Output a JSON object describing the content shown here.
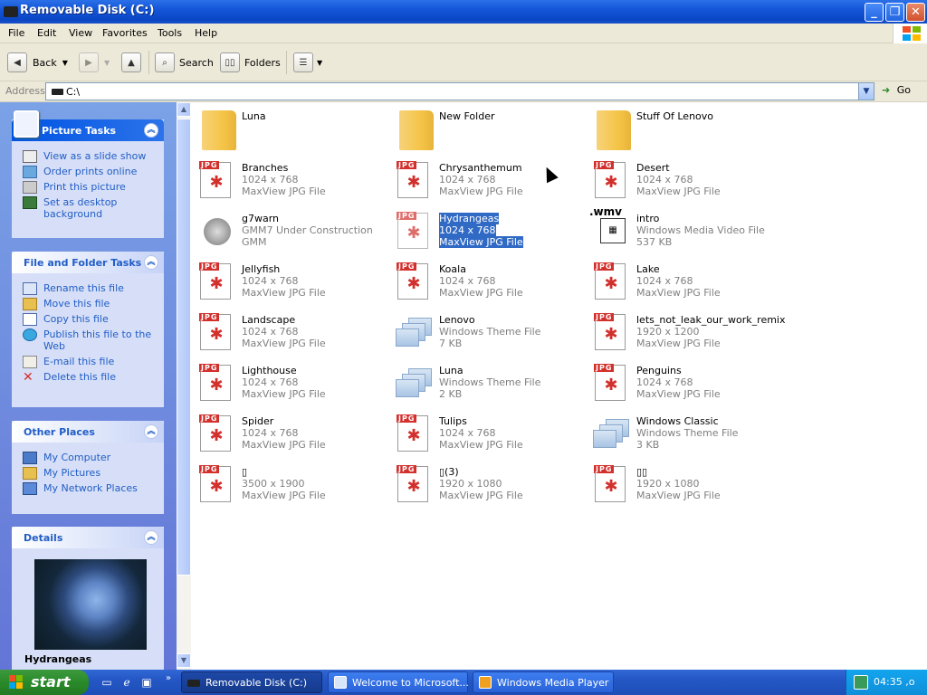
{
  "window": {
    "title": "Removable Disk (C:)"
  },
  "menu": [
    "File",
    "Edit",
    "View",
    "Favorites",
    "Tools",
    "Help"
  ],
  "toolbar": {
    "back_label": "Back",
    "search_label": "Search",
    "folders_label": "Folders"
  },
  "address": {
    "label": "Address",
    "value": "C:\\",
    "go_label": "Go"
  },
  "picture_tasks": {
    "title": "Picture Tasks",
    "items": [
      "View as a slide show",
      "Order prints online",
      "Print this picture",
      "Set as desktop background"
    ]
  },
  "file_tasks": {
    "title": "File and Folder Tasks",
    "items": [
      "Rename this file",
      "Move this file",
      "Copy this file",
      "Publish this file to the Web",
      "E-mail this file",
      "Delete this file"
    ]
  },
  "other_places": {
    "title": "Other Places",
    "items": [
      "My Computer",
      "My Pictures",
      "My Network Places"
    ]
  },
  "details": {
    "title": "Details",
    "name": "Hydrangeas"
  },
  "files": [
    {
      "name": "Luna",
      "line2": "",
      "line3": "",
      "type": "folder"
    },
    {
      "name": "New Folder",
      "line2": "",
      "line3": "",
      "type": "folder"
    },
    {
      "name": "Stuff Of Lenovo",
      "line2": "",
      "line3": "",
      "type": "folder"
    },
    {
      "name": "Branches",
      "line2": "1024 x 768",
      "line3": "MaxView JPG File",
      "type": "jpg"
    },
    {
      "name": "Chrysanthemum",
      "line2": "1024 x 768",
      "line3": "MaxView JPG File",
      "type": "jpg"
    },
    {
      "name": "Desert",
      "line2": "1024 x 768",
      "line3": "MaxView JPG File",
      "type": "jpg"
    },
    {
      "name": "g7warn",
      "line2": "GMM7 Under Construction",
      "line3": "GMM",
      "type": "gmm"
    },
    {
      "name": "Hydrangeas",
      "line2": "1024 x 768",
      "line3": "MaxView JPG File",
      "type": "jpg",
      "selected": true
    },
    {
      "name": "intro",
      "line2": "Windows Media Video File",
      "line3": "537 KB",
      "type": "wmv"
    },
    {
      "name": "Jellyfish",
      "line2": "1024 x 768",
      "line3": "MaxView JPG File",
      "type": "jpg"
    },
    {
      "name": "Koala",
      "line2": "1024 x 768",
      "line3": "MaxView JPG File",
      "type": "jpg"
    },
    {
      "name": "Lake",
      "line2": "1024 x 768",
      "line3": "MaxView JPG File",
      "type": "jpg"
    },
    {
      "name": "Landscape",
      "line2": "1024 x 768",
      "line3": "MaxView JPG File",
      "type": "jpg"
    },
    {
      "name": "Lenovo",
      "line2": "Windows Theme File",
      "line3": "7 KB",
      "type": "theme"
    },
    {
      "name": "lets_not_leak_our_work_remix",
      "line2": "1920 x 1200",
      "line3": "MaxView JPG File",
      "type": "jpg"
    },
    {
      "name": "Lighthouse",
      "line2": "1024 x 768",
      "line3": "MaxView JPG File",
      "type": "jpg"
    },
    {
      "name": "Luna",
      "line2": "Windows Theme File",
      "line3": "2 KB",
      "type": "theme"
    },
    {
      "name": "Penguins",
      "line2": "1024 x 768",
      "line3": "MaxView JPG File",
      "type": "jpg"
    },
    {
      "name": "Spider",
      "line2": "1024 x 768",
      "line3": "MaxView JPG File",
      "type": "jpg"
    },
    {
      "name": "Tulips",
      "line2": "1024 x 768",
      "line3": "MaxView JPG File",
      "type": "jpg"
    },
    {
      "name": "Windows Classic",
      "line2": "Windows Theme File",
      "line3": "3 KB",
      "type": "theme"
    },
    {
      "name": "▯",
      "line2": "3500 x 1900",
      "line3": "MaxView JPG File",
      "type": "jpg"
    },
    {
      "name": "▯(3)",
      "line2": "1920 x 1080",
      "line3": "MaxView JPG File",
      "type": "jpg"
    },
    {
      "name": "▯▯",
      "line2": "1920 x 1080",
      "line3": "MaxView JPG File",
      "type": "jpg"
    }
  ],
  "taskbar": {
    "start_label": "start",
    "buttons": [
      "Removable Disk (C:)",
      "Welcome to Microsoft...",
      "Windows Media Player"
    ],
    "clock": "04:35 ,o"
  },
  "icons": {
    "jpg_label": "JPG",
    "wmv_label": ".wmv"
  }
}
